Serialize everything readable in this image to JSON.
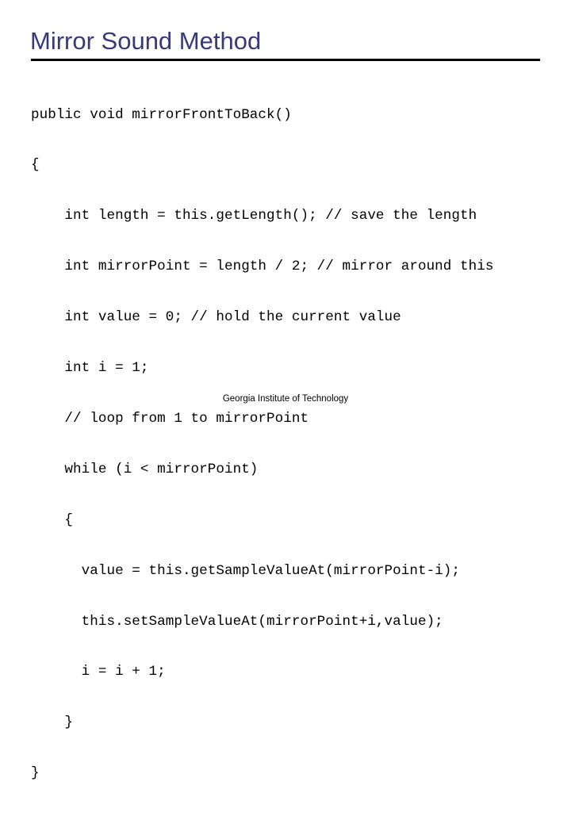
{
  "slide": {
    "title": "Mirror Sound Method",
    "title_color": "#39397a",
    "rule_color": "#000000",
    "background_color": "#ffffff",
    "footer": "Georgia Institute of Technology",
    "code_lines": [
      "public void mirrorFrontToBack()",
      "{",
      "    int length = this.getLength(); // save the length",
      "    int mirrorPoint = length / 2; // mirror around this",
      "    int value = 0; // hold the current value",
      "    int i = 1;",
      "    // loop from 1 to mirrorPoint",
      "    while (i < mirrorPoint)",
      "    {",
      "      value = this.getSampleValueAt(mirrorPoint-i);",
      "      this.setSampleValueAt(mirrorPoint+i,value);",
      "      i = i + 1;",
      "    }",
      "}"
    ]
  }
}
